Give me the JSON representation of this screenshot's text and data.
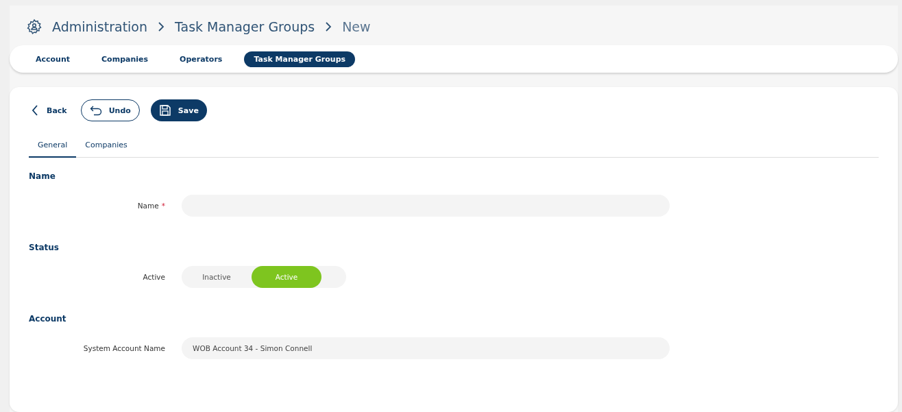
{
  "breadcrumb": [
    "Administration",
    "Task Manager Groups",
    "New"
  ],
  "nav_tabs": [
    {
      "label": "Account",
      "selected": false
    },
    {
      "label": "Companies",
      "selected": false
    },
    {
      "label": "Operators",
      "selected": false
    },
    {
      "label": "Task Manager Groups",
      "selected": true
    }
  ],
  "toolbar": {
    "back": "Back",
    "undo": "Undo",
    "save": "Save"
  },
  "form_tabs": [
    {
      "label": "General",
      "selected": true
    },
    {
      "label": "Companies",
      "selected": false
    }
  ],
  "sections": [
    {
      "title": "Name",
      "fields": [
        {
          "kind": "text",
          "label": "Name",
          "required_mark": "*"
        }
      ]
    },
    {
      "title": "Status",
      "fields": [
        {
          "kind": "toggle",
          "label": "Active",
          "options": [
            {
              "label": "Inactive",
              "selected": false
            },
            {
              "label": "Active",
              "selected": true
            }
          ]
        }
      ]
    },
    {
      "title": "Account",
      "fields": [
        {
          "kind": "text",
          "label": "System Account Name",
          "value": "WOB Account 34 - Simon Connell"
        }
      ]
    }
  ]
}
